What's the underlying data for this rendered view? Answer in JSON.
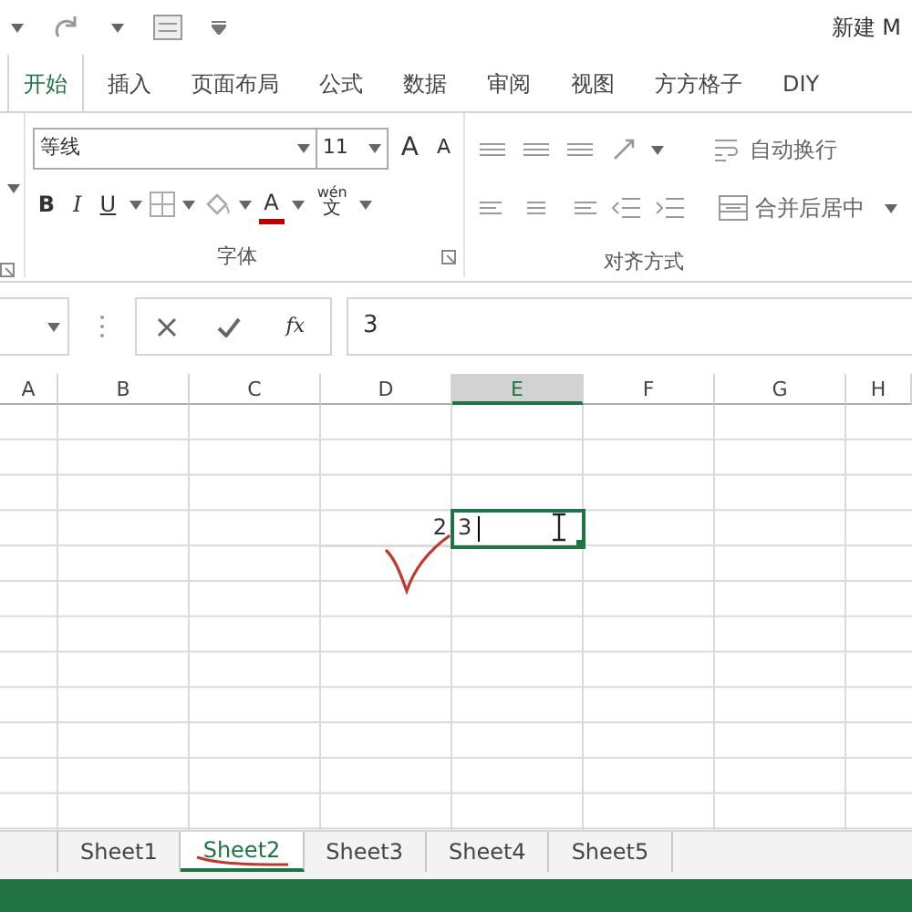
{
  "title_bar": {
    "title": "新建 M"
  },
  "ribbon_tabs": [
    {
      "label": "开始",
      "selected": true
    },
    {
      "label": "插入",
      "selected": false
    },
    {
      "label": "页面布局",
      "selected": false
    },
    {
      "label": "公式",
      "selected": false
    },
    {
      "label": "数据",
      "selected": false
    },
    {
      "label": "审阅",
      "selected": false
    },
    {
      "label": "视图",
      "selected": false
    },
    {
      "label": "方方格子",
      "selected": false
    },
    {
      "label": "DIY",
      "selected": false
    }
  ],
  "font_group": {
    "font_name": "等线",
    "font_size": "11",
    "grow_label": "A",
    "shrink_label": "A",
    "bold": "B",
    "italic": "I",
    "underline": "U",
    "font_color": "A",
    "phonetic_top": "wén",
    "phonetic_bottom": "文",
    "label": "字体"
  },
  "alignment_group": {
    "wrap_text": "自动换行",
    "merge_center": "合并后居中",
    "label": "对齐方式"
  },
  "formula_bar": {
    "function_label": "fx",
    "value": "3"
  },
  "columns": [
    {
      "label": "A",
      "selected": false
    },
    {
      "label": "B",
      "selected": false
    },
    {
      "label": "C",
      "selected": false
    },
    {
      "label": "D",
      "selected": false
    },
    {
      "label": "E",
      "selected": true
    },
    {
      "label": "F",
      "selected": false
    },
    {
      "label": "G",
      "selected": false
    },
    {
      "label": "H",
      "selected": false
    }
  ],
  "entry_row": {
    "cells": [
      {
        "value": "2",
        "editing": false
      },
      {
        "value": "3",
        "editing": true
      }
    ]
  },
  "sheet_tabs": [
    {
      "label": "Sheet1",
      "selected": false
    },
    {
      "label": "Sheet2",
      "selected": true
    },
    {
      "label": "Sheet3",
      "selected": false
    },
    {
      "label": "Sheet4",
      "selected": false
    },
    {
      "label": "Sheet5",
      "selected": false
    }
  ]
}
